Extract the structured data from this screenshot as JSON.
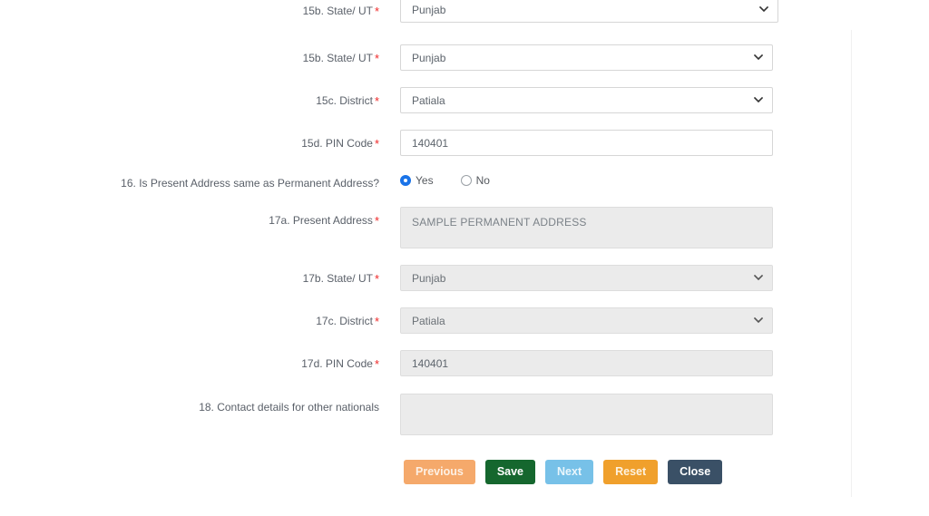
{
  "form": {
    "rows": [
      {
        "id": "15b-state-ut-top",
        "label": "15b. State/ UT",
        "required": true,
        "control": "select",
        "value": "Punjab",
        "disabled": false,
        "wide": true
      },
      {
        "id": "15b-state-ut",
        "label": "15b. State/ UT",
        "required": true,
        "control": "select",
        "value": "Punjab",
        "disabled": false,
        "wide": false
      },
      {
        "id": "15c-district",
        "label": "15c. District",
        "required": true,
        "control": "select",
        "value": "Patiala",
        "disabled": false,
        "wide": false
      },
      {
        "id": "15d-pin-code",
        "label": "15d. PIN Code",
        "required": true,
        "control": "text",
        "value": "140401",
        "disabled": false
      },
      {
        "id": "16-present-same-as-permanent",
        "label": "16. Is Present Address same as Permanent Address?",
        "required": false,
        "control": "radio",
        "value": "Yes",
        "options": [
          "Yes",
          "No"
        ]
      },
      {
        "id": "17a-present-address",
        "label": "17a. Present Address",
        "required": true,
        "control": "textarea",
        "value": "SAMPLE PERMANENT ADDRESS",
        "disabled": true
      },
      {
        "id": "17b-state-ut",
        "label": "17b. State/ UT",
        "required": true,
        "control": "select",
        "value": "Punjab",
        "disabled": true,
        "wide": false
      },
      {
        "id": "17c-district",
        "label": "17c. District",
        "required": true,
        "control": "select",
        "value": "Patiala",
        "disabled": true,
        "wide": false
      },
      {
        "id": "17d-pin-code",
        "label": "17d. PIN Code",
        "required": true,
        "control": "text",
        "value": "140401",
        "disabled": true
      },
      {
        "id": "18-contact-details-other-nationals",
        "label": "18. Contact details for other nationals",
        "required": false,
        "control": "textarea",
        "value": "",
        "disabled": true
      }
    ],
    "required_marker": "*"
  },
  "buttons": {
    "previous": "Previous",
    "save": "Save",
    "next": "Next",
    "reset": "Reset",
    "close": "Close"
  },
  "colors": {
    "required_asterisk": "#ef2929",
    "radio_selected": "#1a73e8",
    "btn_previous": "#f5a96b",
    "btn_save": "#15672e",
    "btn_next": "#77c1e8",
    "btn_reset": "#f0a02c",
    "btn_close": "#3a5066",
    "disabled_field_bg": "#ebebeb",
    "field_border": "#d6d6d6"
  }
}
